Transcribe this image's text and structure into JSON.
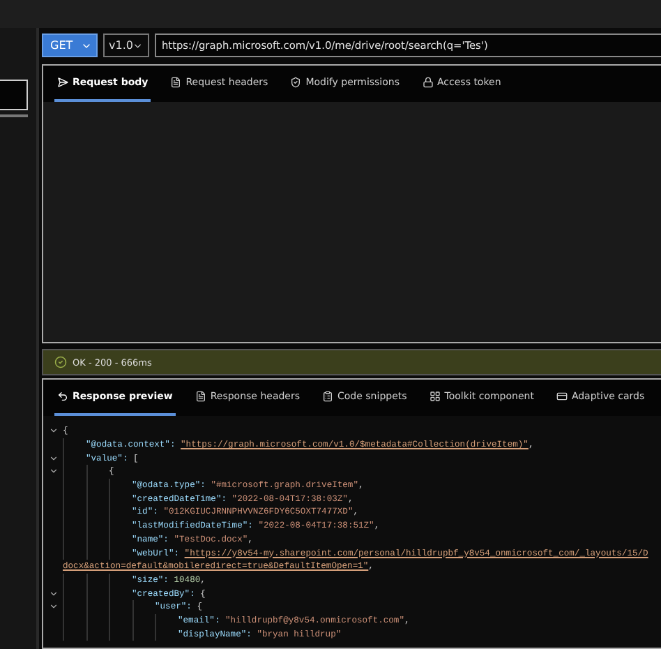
{
  "toolbar": {
    "method": "GET",
    "version": "v1.0",
    "url": "https://graph.microsoft.com/v1.0/me/drive/root/search(q='Tes')"
  },
  "request_tabs": [
    {
      "label": "Request body",
      "selected": true
    },
    {
      "label": "Request headers",
      "selected": false
    },
    {
      "label": "Modify permissions",
      "selected": false
    },
    {
      "label": "Access token",
      "selected": false
    }
  ],
  "status": {
    "text": "OK - 200 - 666ms",
    "kind": "success"
  },
  "response_tabs": [
    {
      "label": "Response preview",
      "selected": true
    },
    {
      "label": "Response headers",
      "selected": false
    },
    {
      "label": "Code snippets",
      "selected": false
    },
    {
      "label": "Toolkit component",
      "selected": false
    },
    {
      "label": "Adaptive cards",
      "selected": false
    }
  ],
  "response": [
    {
      "value": "{",
      "children": [
        {
          "key": "\"@odata.context\": ",
          "value": "\"https://graph.microsoft.com/v1.0/$metadata#Collection(driveItem)\"",
          "kind": "link",
          "tail": ","
        },
        {
          "key": "\"value\": ",
          "value": "[",
          "children": [
            {
              "value": "{",
              "children": [
                {
                  "key": "\"@odata.type\": ",
                  "value": "\"#microsoft.graph.driveItem\"",
                  "kind": "string",
                  "tail": ","
                },
                {
                  "key": "\"createdDateTime\": ",
                  "value": "\"2022-08-04T17:38:03Z\"",
                  "kind": "string",
                  "tail": ","
                },
                {
                  "key": "\"id\": ",
                  "value": "\"012KGIUCJRNNPHVVNZ6FDY6C5OXT7477XD\"",
                  "kind": "string",
                  "tail": ","
                },
                {
                  "key": "\"lastModifiedDateTime\": ",
                  "value": "\"2022-08-04T17:38:51Z\"",
                  "kind": "string",
                  "tail": ","
                },
                {
                  "key": "\"name\": ",
                  "value": "\"TestDoc.docx\"",
                  "kind": "string",
                  "tail": ","
                },
                {
                  "key": "\"webUrl\": ",
                  "value": "\"https://y8v54-my.sharepoint.com/personal/hilldrupbf_y8v54_onmicrosoft_com/_layouts/15/D",
                  "kind": "link",
                  "wrap": "docx&action=default&mobileredirect=true&DefaultItemOpen=1\"",
                  "tail": ","
                },
                {
                  "key": "\"size\": ",
                  "value": "10480",
                  "kind": "number",
                  "tail": ","
                },
                {
                  "key": "\"createdBy\": ",
                  "value": "{",
                  "children": [
                    {
                      "key": "\"user\": ",
                      "value": "{",
                      "children": [
                        {
                          "key": "\"email\": ",
                          "value": "\"hilldrupbf@y8v54.onmicrosoft.com\"",
                          "kind": "string",
                          "tail": ","
                        },
                        {
                          "key": "\"displayName\": ",
                          "value": "\"bryan hilldrup\"",
                          "kind": "string"
                        }
                      ]
                    }
                  ]
                }
              ]
            }
          ]
        }
      ]
    }
  ]
}
